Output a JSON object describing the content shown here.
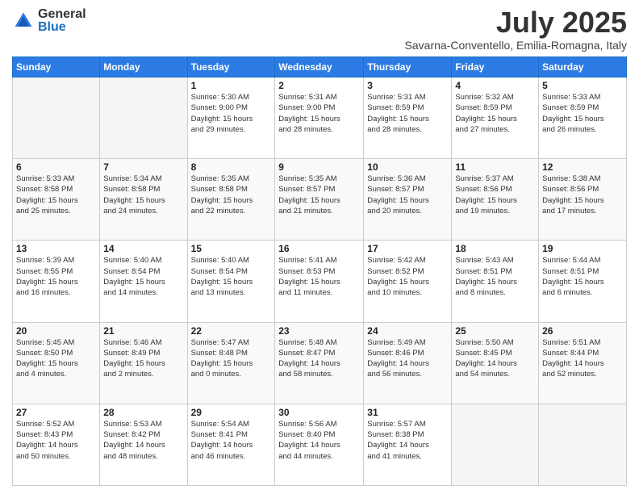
{
  "logo": {
    "general": "General",
    "blue": "Blue"
  },
  "header": {
    "month": "July 2025",
    "location": "Savarna-Conventello, Emilia-Romagna, Italy"
  },
  "days_of_week": [
    "Sunday",
    "Monday",
    "Tuesday",
    "Wednesday",
    "Thursday",
    "Friday",
    "Saturday"
  ],
  "weeks": [
    [
      {
        "day": "",
        "info": ""
      },
      {
        "day": "",
        "info": ""
      },
      {
        "day": "1",
        "info": "Sunrise: 5:30 AM\nSunset: 9:00 PM\nDaylight: 15 hours\nand 29 minutes."
      },
      {
        "day": "2",
        "info": "Sunrise: 5:31 AM\nSunset: 9:00 PM\nDaylight: 15 hours\nand 28 minutes."
      },
      {
        "day": "3",
        "info": "Sunrise: 5:31 AM\nSunset: 8:59 PM\nDaylight: 15 hours\nand 28 minutes."
      },
      {
        "day": "4",
        "info": "Sunrise: 5:32 AM\nSunset: 8:59 PM\nDaylight: 15 hours\nand 27 minutes."
      },
      {
        "day": "5",
        "info": "Sunrise: 5:33 AM\nSunset: 8:59 PM\nDaylight: 15 hours\nand 26 minutes."
      }
    ],
    [
      {
        "day": "6",
        "info": "Sunrise: 5:33 AM\nSunset: 8:58 PM\nDaylight: 15 hours\nand 25 minutes."
      },
      {
        "day": "7",
        "info": "Sunrise: 5:34 AM\nSunset: 8:58 PM\nDaylight: 15 hours\nand 24 minutes."
      },
      {
        "day": "8",
        "info": "Sunrise: 5:35 AM\nSunset: 8:58 PM\nDaylight: 15 hours\nand 22 minutes."
      },
      {
        "day": "9",
        "info": "Sunrise: 5:35 AM\nSunset: 8:57 PM\nDaylight: 15 hours\nand 21 minutes."
      },
      {
        "day": "10",
        "info": "Sunrise: 5:36 AM\nSunset: 8:57 PM\nDaylight: 15 hours\nand 20 minutes."
      },
      {
        "day": "11",
        "info": "Sunrise: 5:37 AM\nSunset: 8:56 PM\nDaylight: 15 hours\nand 19 minutes."
      },
      {
        "day": "12",
        "info": "Sunrise: 5:38 AM\nSunset: 8:56 PM\nDaylight: 15 hours\nand 17 minutes."
      }
    ],
    [
      {
        "day": "13",
        "info": "Sunrise: 5:39 AM\nSunset: 8:55 PM\nDaylight: 15 hours\nand 16 minutes."
      },
      {
        "day": "14",
        "info": "Sunrise: 5:40 AM\nSunset: 8:54 PM\nDaylight: 15 hours\nand 14 minutes."
      },
      {
        "day": "15",
        "info": "Sunrise: 5:40 AM\nSunset: 8:54 PM\nDaylight: 15 hours\nand 13 minutes."
      },
      {
        "day": "16",
        "info": "Sunrise: 5:41 AM\nSunset: 8:53 PM\nDaylight: 15 hours\nand 11 minutes."
      },
      {
        "day": "17",
        "info": "Sunrise: 5:42 AM\nSunset: 8:52 PM\nDaylight: 15 hours\nand 10 minutes."
      },
      {
        "day": "18",
        "info": "Sunrise: 5:43 AM\nSunset: 8:51 PM\nDaylight: 15 hours\nand 8 minutes."
      },
      {
        "day": "19",
        "info": "Sunrise: 5:44 AM\nSunset: 8:51 PM\nDaylight: 15 hours\nand 6 minutes."
      }
    ],
    [
      {
        "day": "20",
        "info": "Sunrise: 5:45 AM\nSunset: 8:50 PM\nDaylight: 15 hours\nand 4 minutes."
      },
      {
        "day": "21",
        "info": "Sunrise: 5:46 AM\nSunset: 8:49 PM\nDaylight: 15 hours\nand 2 minutes."
      },
      {
        "day": "22",
        "info": "Sunrise: 5:47 AM\nSunset: 8:48 PM\nDaylight: 15 hours\nand 0 minutes."
      },
      {
        "day": "23",
        "info": "Sunrise: 5:48 AM\nSunset: 8:47 PM\nDaylight: 14 hours\nand 58 minutes."
      },
      {
        "day": "24",
        "info": "Sunrise: 5:49 AM\nSunset: 8:46 PM\nDaylight: 14 hours\nand 56 minutes."
      },
      {
        "day": "25",
        "info": "Sunrise: 5:50 AM\nSunset: 8:45 PM\nDaylight: 14 hours\nand 54 minutes."
      },
      {
        "day": "26",
        "info": "Sunrise: 5:51 AM\nSunset: 8:44 PM\nDaylight: 14 hours\nand 52 minutes."
      }
    ],
    [
      {
        "day": "27",
        "info": "Sunrise: 5:52 AM\nSunset: 8:43 PM\nDaylight: 14 hours\nand 50 minutes."
      },
      {
        "day": "28",
        "info": "Sunrise: 5:53 AM\nSunset: 8:42 PM\nDaylight: 14 hours\nand 48 minutes."
      },
      {
        "day": "29",
        "info": "Sunrise: 5:54 AM\nSunset: 8:41 PM\nDaylight: 14 hours\nand 46 minutes."
      },
      {
        "day": "30",
        "info": "Sunrise: 5:56 AM\nSunset: 8:40 PM\nDaylight: 14 hours\nand 44 minutes."
      },
      {
        "day": "31",
        "info": "Sunrise: 5:57 AM\nSunset: 8:38 PM\nDaylight: 14 hours\nand 41 minutes."
      },
      {
        "day": "",
        "info": ""
      },
      {
        "day": "",
        "info": ""
      }
    ]
  ]
}
